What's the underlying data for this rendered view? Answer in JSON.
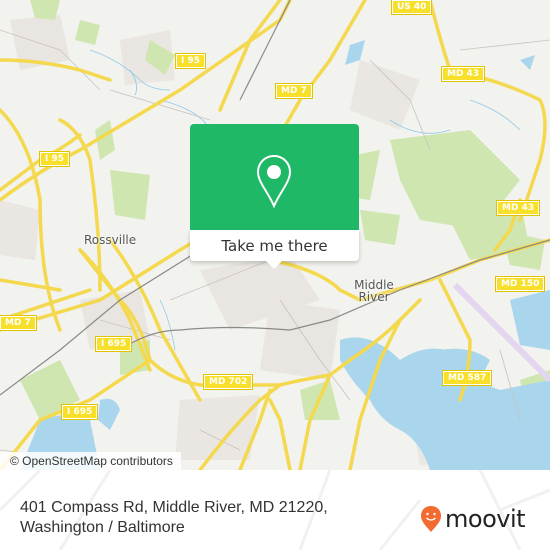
{
  "map": {
    "shields": [
      {
        "label": "US 40"
      },
      {
        "label": "I 95"
      },
      {
        "label": "MD 7"
      },
      {
        "label": "MD 43"
      },
      {
        "label": "I 95"
      },
      {
        "label": "MD 43"
      },
      {
        "label": "MD 7"
      },
      {
        "label": "MD 150"
      },
      {
        "label": "I 695"
      },
      {
        "label": "MD 702"
      },
      {
        "label": "MD 587"
      },
      {
        "label": "I 695"
      }
    ],
    "places": [
      {
        "label": "Rossville"
      },
      {
        "label": "Middle River"
      }
    ],
    "attribution": "© OpenStreetMap contributors"
  },
  "popup": {
    "button_label": "Take me there",
    "accent_color": "#1fb866",
    "icon": "location-pin-icon"
  },
  "footer": {
    "address_line1": "401 Compass Rd, Middle River, MD 21220,",
    "address_line2": "Washington / Baltimore",
    "logo_text": "moovit",
    "logo_color": "#f26b30"
  }
}
